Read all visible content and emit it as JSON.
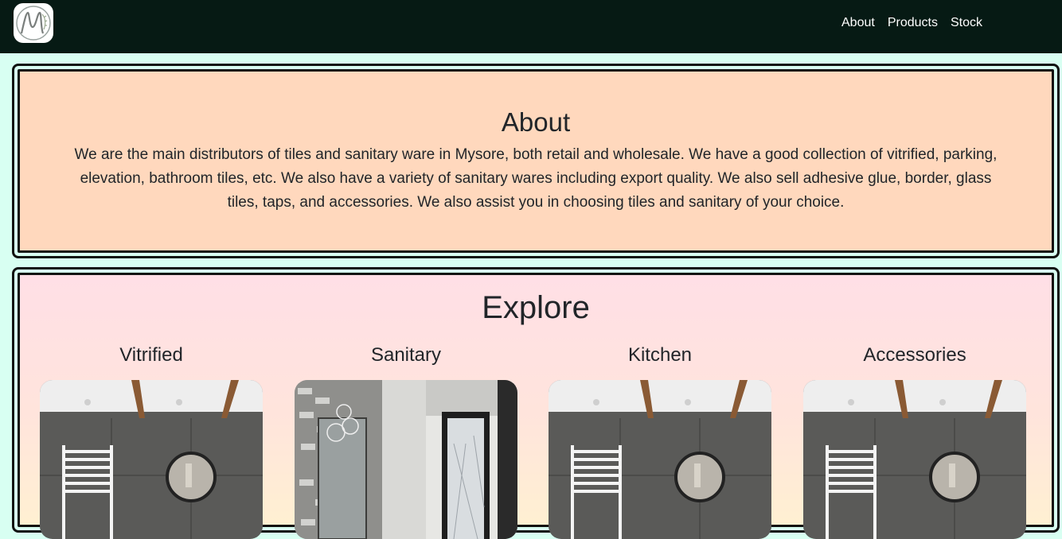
{
  "nav": {
    "logo_alt": "M",
    "links": [
      "About",
      "Products",
      "Stock"
    ]
  },
  "about": {
    "title": "About",
    "text": "We are the main distributors of tiles and sanitary ware in Mysore, both retail and wholesale. We have a good collection of vitrified, parking, elevation, bathroom tiles, etc. We also have a variety of sanitary wares including export quality. We also sell adhesive glue, border, glass tiles, taps, and accessories. We also assist you in choosing tiles and sanitary of your choice."
  },
  "explore": {
    "title": "Explore",
    "categories": [
      {
        "label": "Vitrified",
        "image": "bathroom-photo"
      },
      {
        "label": "Sanitary",
        "image": "shower-photo"
      },
      {
        "label": "Kitchen",
        "image": "bathroom-photo"
      },
      {
        "label": "Accessories",
        "image": "bathroom-photo"
      }
    ]
  },
  "colors": {
    "navbar": "#061a14",
    "page_bg": "#d8fff2",
    "about_bg": "#ffd8bd",
    "explore_bg_top": "#ffdfe6",
    "explore_bg_bottom": "#fff0d2"
  }
}
